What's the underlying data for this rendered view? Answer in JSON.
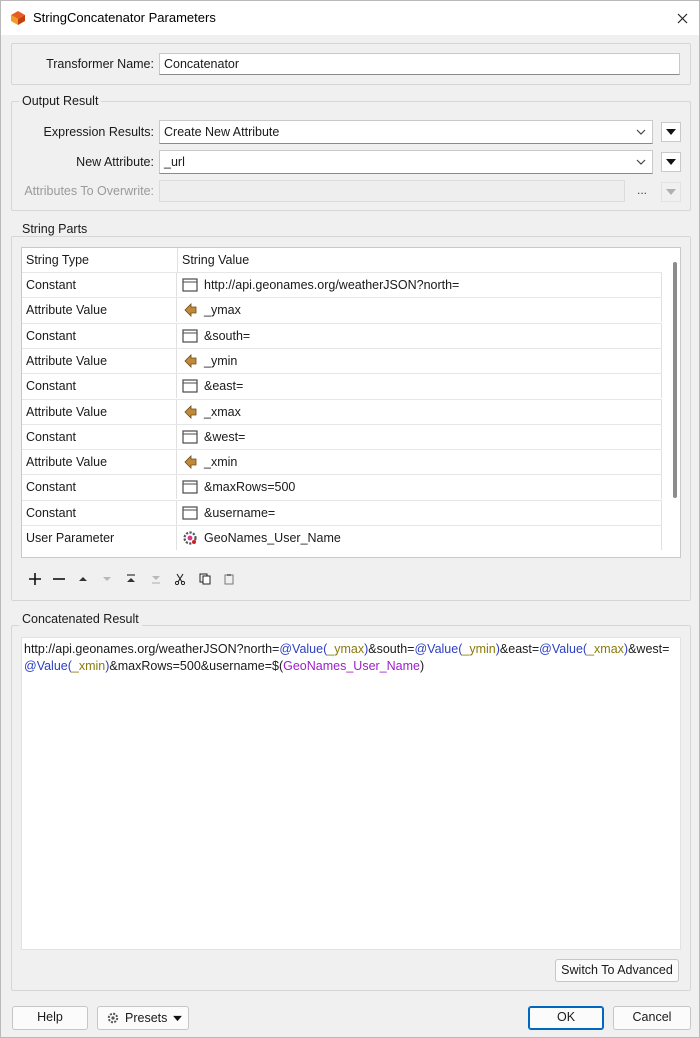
{
  "window": {
    "title": "StringConcatenator Parameters"
  },
  "transformer": {
    "label": "Transformer Name:",
    "value": "Concatenator"
  },
  "output_result": {
    "group_label": "Output Result",
    "expression_results": {
      "label": "Expression Results:",
      "value": "Create New Attribute"
    },
    "new_attribute": {
      "label": "New Attribute:",
      "value": "_url"
    },
    "attributes_to_overwrite": {
      "label": "Attributes To Overwrite:",
      "value": "",
      "button": "..."
    }
  },
  "string_parts": {
    "group_label": "String Parts",
    "columns": [
      "String Type",
      "String Value"
    ],
    "rows": [
      {
        "type": "Constant",
        "value": "http://api.geonames.org/weatherJSON?north=",
        "icon": "constant-icon"
      },
      {
        "type": "Attribute Value",
        "value": "_ymax",
        "icon": "attribute-icon"
      },
      {
        "type": "Constant",
        "value": "&south=",
        "icon": "constant-icon"
      },
      {
        "type": "Attribute Value",
        "value": "_ymin",
        "icon": "attribute-icon"
      },
      {
        "type": "Constant",
        "value": "&east=",
        "icon": "constant-icon"
      },
      {
        "type": "Attribute Value",
        "value": "_xmax",
        "icon": "attribute-icon"
      },
      {
        "type": "Constant",
        "value": "&west=",
        "icon": "constant-icon"
      },
      {
        "type": "Attribute Value",
        "value": "_xmin",
        "icon": "attribute-icon"
      },
      {
        "type": "Constant",
        "value": "&maxRows=500",
        "icon": "constant-icon"
      },
      {
        "type": "Constant",
        "value": "&username=",
        "icon": "constant-icon"
      },
      {
        "type": "User Parameter",
        "value": "GeoNames_User_Name",
        "icon": "user-parameter-icon"
      }
    ]
  },
  "concatenated": {
    "group_label": "Concatenated Result",
    "parts": [
      {
        "t": "http://api.geonames.org/weatherJSON?north=",
        "k": "text"
      },
      {
        "t": "@Value(",
        "k": "fn"
      },
      {
        "t": "_ymax",
        "k": "arg"
      },
      {
        "t": ")",
        "k": "fn"
      },
      {
        "t": "&south=",
        "k": "text"
      },
      {
        "t": "@Value(",
        "k": "fn"
      },
      {
        "t": "_ymin",
        "k": "arg"
      },
      {
        "t": ")",
        "k": "fn"
      },
      {
        "t": "&east=",
        "k": "text"
      },
      {
        "t": "@Value(",
        "k": "fn"
      },
      {
        "t": "_xmax",
        "k": "arg"
      },
      {
        "t": ")",
        "k": "fn"
      },
      {
        "t": "&west=",
        "k": "text"
      },
      {
        "t": "@Value(",
        "k": "fn"
      },
      {
        "t": "_xmin",
        "k": "arg"
      },
      {
        "t": ")",
        "k": "fn"
      },
      {
        "t": "&maxRows=500&username=$(",
        "k": "text"
      },
      {
        "t": "GeoNames_User_Name",
        "k": "pm"
      },
      {
        "t": ")",
        "k": "text"
      }
    ],
    "switch_button": "Switch To Advanced"
  },
  "footer": {
    "help": "Help",
    "presets": "Presets",
    "ok": "OK",
    "cancel": "Cancel"
  }
}
